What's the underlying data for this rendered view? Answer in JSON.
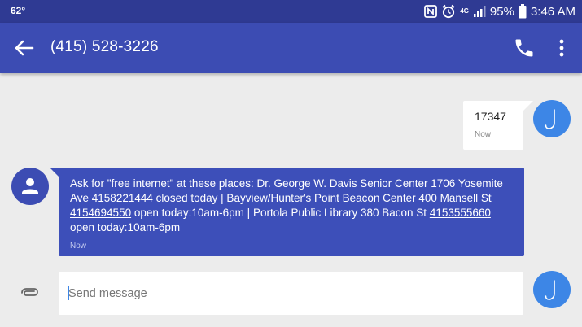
{
  "status_bar": {
    "temperature": "62°",
    "nfc_icon": "nfc-icon",
    "alarm_icon": "alarm-icon",
    "network": "4G",
    "battery": "95%",
    "time": "3:46 AM"
  },
  "app_bar": {
    "title": "(415) 528-3226",
    "back_icon": "arrow-back-icon",
    "call_icon": "phone-icon",
    "menu_icon": "more-vert-icon"
  },
  "messages": [
    {
      "direction": "outgoing",
      "text": "17347",
      "time": "Now"
    },
    {
      "direction": "incoming",
      "segments": [
        "Ask for \"free internet\" at these places: Dr. George W. Davis Senior Center 1706 Yosemite Ave ",
        "4158221444",
        " closed today | Bayview/Hunter's Point Beacon Center 400 Mansell St ",
        "4154694550",
        " open today:10am-6pm | Portola Public Library 380 Bacon St ",
        "4153555660",
        " open today:10am-6pm"
      ],
      "time": "Now"
    }
  ],
  "compose": {
    "placeholder": "Send message",
    "attach_icon": "paperclip-icon"
  },
  "colors": {
    "status_bar": "#2f3a93",
    "app_bar": "#3c4cb3",
    "incoming_bubble": "#3d4fb9",
    "outgoing_avatar": "#3d86e6",
    "background": "#ececec"
  }
}
